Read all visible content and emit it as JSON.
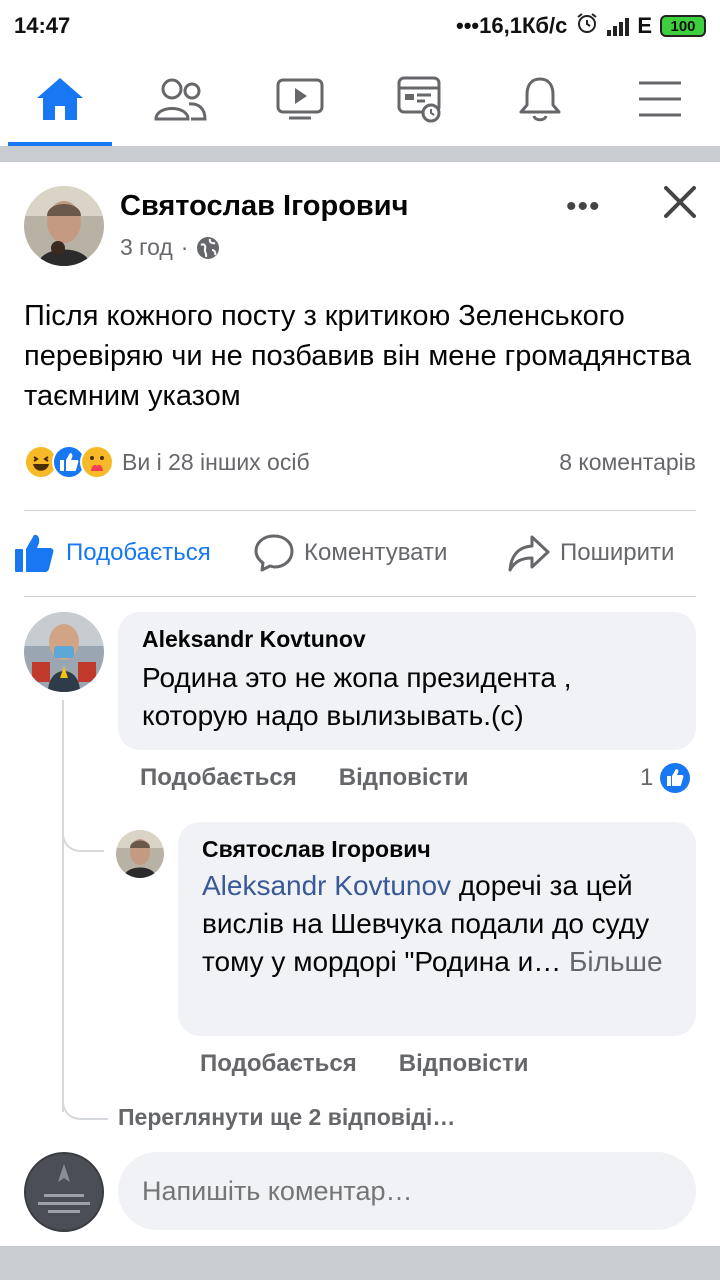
{
  "status_bar": {
    "time": "14:47",
    "speed": "16,1Кб/с",
    "network": "E",
    "battery": "100"
  },
  "nav": {
    "items": [
      {
        "icon": "home-icon",
        "active": true
      },
      {
        "icon": "friends-icon",
        "active": false
      },
      {
        "icon": "watch-icon",
        "active": false
      },
      {
        "icon": "news-icon",
        "active": false
      },
      {
        "icon": "bell-icon",
        "active": false
      },
      {
        "icon": "menu-icon",
        "active": false
      }
    ]
  },
  "post": {
    "author": "Святослав Ігорович",
    "time": "3 год",
    "privacy_separator": "·",
    "more_label": "•••",
    "text": "Після кожного посту з критикою Зеленського перевіряю чи не позбавив він мене громадянства таємним указом",
    "reactions_text": "Ви і 28 інших осіб",
    "comments_count": "8 коментарів",
    "actions": {
      "like": "Подобається",
      "comment": "Коментувати",
      "share": "Поширити"
    }
  },
  "comments": [
    {
      "author": "Aleksandr Kovtunov",
      "text": "Родина это не жопа президента , которую надо вылизывать.(с)",
      "like_label": "Подобається",
      "reply_label": "Відповісти",
      "likes": "1"
    }
  ],
  "reply": {
    "author": "Святослав Ігорович",
    "mention": "Aleksandr Kovtunov",
    "text": " доречі за цей вислів на Шевчука подали до суду тому у мордорі \"Родина и…",
    "more": " Більше",
    "like_label": "Подобається",
    "reply_label": "Відповісти"
  },
  "view_more_replies": "Переглянути ще 2 відповіді…",
  "comment_input": {
    "placeholder": "Напишіть коментар…"
  },
  "colors": {
    "accent": "#1877f2",
    "secondary_text": "#65676b",
    "bubble": "#f0f2f5",
    "mention": "#385898"
  }
}
